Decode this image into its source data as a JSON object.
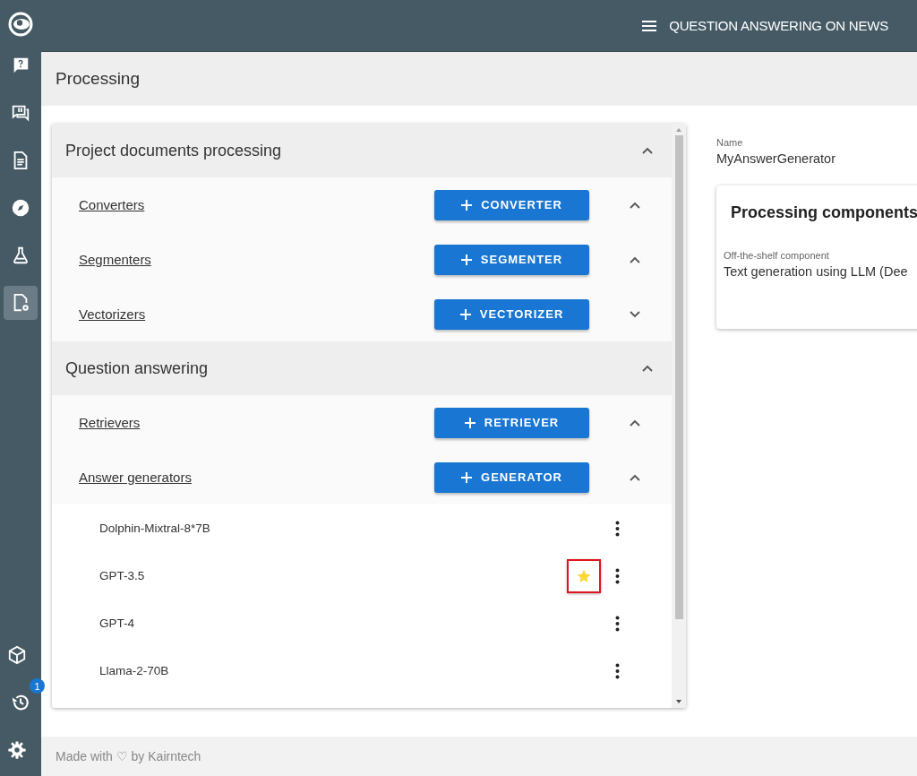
{
  "app_bar": {
    "title": "QUESTION ANSWERING ON NEWS"
  },
  "sidebar": {
    "top_items": [
      {
        "selected": false
      },
      {
        "selected": false
      },
      {
        "selected": false
      },
      {
        "selected": false
      },
      {
        "selected": false
      },
      {
        "selected": true
      }
    ],
    "bottom_items": [
      {
        "selected": false
      },
      {
        "selected": false,
        "badge": "1"
      },
      {
        "selected": false
      }
    ]
  },
  "page_title": "Processing",
  "sections": [
    {
      "title": "Project documents processing",
      "expanded": true,
      "groups": [
        {
          "label": "Converters",
          "button": "CONVERTER",
          "expanded": true
        },
        {
          "label": "Segmenters",
          "button": "SEGMENTER",
          "expanded": true
        },
        {
          "label": "Vectorizers",
          "button": "VECTORIZER",
          "expanded": false
        }
      ]
    },
    {
      "title": "Question answering",
      "expanded": true,
      "groups": [
        {
          "label": "Retrievers",
          "button": "RETRIEVER",
          "expanded": true
        },
        {
          "label": "Answer generators",
          "button": "GENERATOR",
          "expanded": true,
          "items": [
            {
              "name": "Dolphin-Mixtral-8*7B",
              "starred": false,
              "highlighted": false
            },
            {
              "name": "GPT-3.5",
              "starred": true,
              "highlighted": true
            },
            {
              "name": "GPT-4",
              "starred": false,
              "highlighted": false
            },
            {
              "name": "Llama-2-70B",
              "starred": false,
              "highlighted": false
            }
          ]
        }
      ]
    }
  ],
  "detail": {
    "name_label": "Name",
    "name_value": "MyAnswerGenerator",
    "card_title": "Processing components",
    "component_label": "Off-the-shelf component",
    "component_value": "Text generation using LLM (Dee"
  },
  "footer": "Made with ♡ by Kairntech"
}
